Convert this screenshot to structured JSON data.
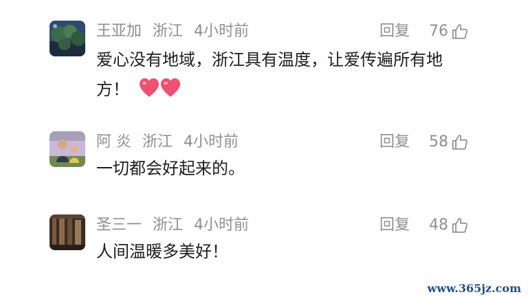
{
  "comments": [
    {
      "user": "王亚加",
      "location": "浙江",
      "time": "4小时前",
      "reply_label": "回复",
      "likes": "76",
      "text": "爱心没有地域，浙江具有温度，让爱传遍所有地方！",
      "emoji": "heart-emoji"
    },
    {
      "user": "阿 炎",
      "location": "浙江",
      "time": "4小时前",
      "reply_label": "回复",
      "likes": "58",
      "text": "一切都会好起来的。"
    },
    {
      "user": "圣三一",
      "location": "浙江",
      "time": "4小时前",
      "reply_label": "回复",
      "likes": "48",
      "text": "人间温暖多美好！"
    }
  ],
  "watermark": "www.365jz.com",
  "colors": {
    "meta_text": "#8f8f8f",
    "body_text": "#1e1e1e",
    "heart": "#f04f6f",
    "watermark": "#1f4f86"
  }
}
